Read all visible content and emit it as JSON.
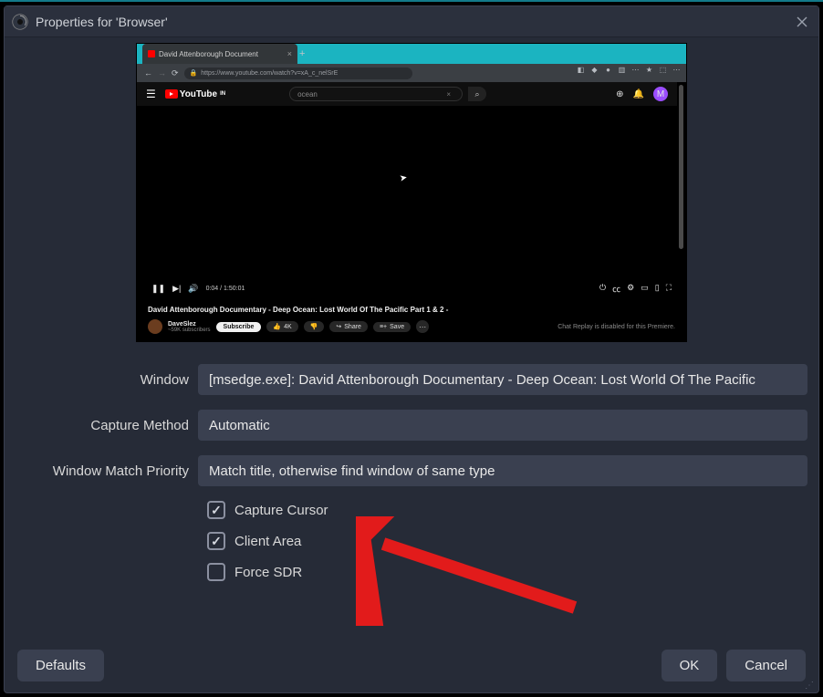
{
  "titlebar": {
    "title": "Properties for 'Browser'"
  },
  "preview": {
    "tab_label": "David Attenborough Document",
    "url": "https://www.youtube.com/watch?v=xA_c_nelSrE",
    "yt_logo": "YouTube",
    "yt_logo_suffix": "IN",
    "search_value": "ocean",
    "avatar_letter": "M",
    "time": "0:04 / 1:50:01",
    "video_title": "David Attenborough Documentary - Deep Ocean: Lost World Of The Pacific Part 1 & 2 -",
    "channel": "DaveSlez",
    "channel_sub": "~59K subscribers",
    "subscribe_label": "Subscribe",
    "like_label": "4K",
    "share_label": "Share",
    "save_label": "Save",
    "chat_note": "Chat Replay is disabled for this Premiere."
  },
  "form": {
    "window_label": "Window",
    "window_value": "[msedge.exe]: David Attenborough Documentary - Deep Ocean: Lost World Of The Pacific",
    "capture_method_label": "Capture Method",
    "capture_method_value": "Automatic",
    "match_priority_label": "Window Match Priority",
    "match_priority_value": "Match title, otherwise find window of same type",
    "capture_cursor_label": "Capture Cursor",
    "client_area_label": "Client Area",
    "force_sdr_label": "Force SDR"
  },
  "footer": {
    "defaults_label": "Defaults",
    "ok_label": "OK",
    "cancel_label": "Cancel"
  }
}
